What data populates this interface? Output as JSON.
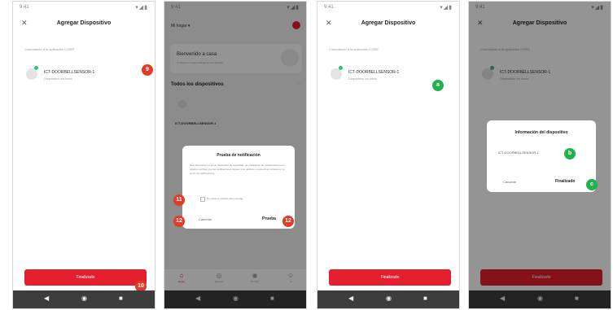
{
  "status": {
    "time": "9:41",
    "icons": "▾◢▮"
  },
  "add_device": {
    "back": "✕",
    "title": "Agregar Dispositivo",
    "hint": "Conectando a la aplicación ICSEE",
    "device_name": "ICT-DOORBELLSENSOR-1",
    "device_sub": "Dispositivo en línea",
    "done": "Finalizado"
  },
  "home": {
    "home_selector": "Mi hogar ▾",
    "welcome": "Bienvenido a casa",
    "welcome_sub": "Configura tu hogar inteligente con facilidad",
    "all_devices": "Todos los dispositivos",
    "more": "···",
    "device_name": "ICT-DOORBELLSENSOR-1",
    "nav": [
      {
        "icon": "⌂",
        "label": "Hogar"
      },
      {
        "icon": "◎",
        "label": "Escena"
      },
      {
        "icon": "◉",
        "label": "Servicio"
      },
      {
        "icon": "☺",
        "label": "Yo"
      }
    ]
  },
  "notification_dialog": {
    "title": "Prueba de notificación",
    "body": "Este dispositivo no es un dispositivo de seguridad. La notificación de prueba tiene como objetivo verificar que las notificaciones lleguen a su teléfono; a veces hay retrasos en el envío de notificaciones.",
    "checkbox_label": "No volver a mostrar este mensaje",
    "cancel": "Cancelar",
    "test": "Prueba"
  },
  "device_info_dialog": {
    "title": "Información del dispositivo",
    "name": "ICT-DOORBELLSENSOR-1",
    "cancel": "Cancelar",
    "done": "Finalizado"
  },
  "navbar": {
    "back": "◀",
    "home": "◉",
    "recent": "■"
  },
  "badges": {
    "b9": "9",
    "b10": "10",
    "b11": "11",
    "b12a": "12",
    "b12b": "12",
    "ba": "a",
    "bb": "b",
    "bc": "c"
  },
  "colors": {
    "brand_red": "#e5202e",
    "badge_red": "#e03c28",
    "badge_green": "#22b14c"
  }
}
